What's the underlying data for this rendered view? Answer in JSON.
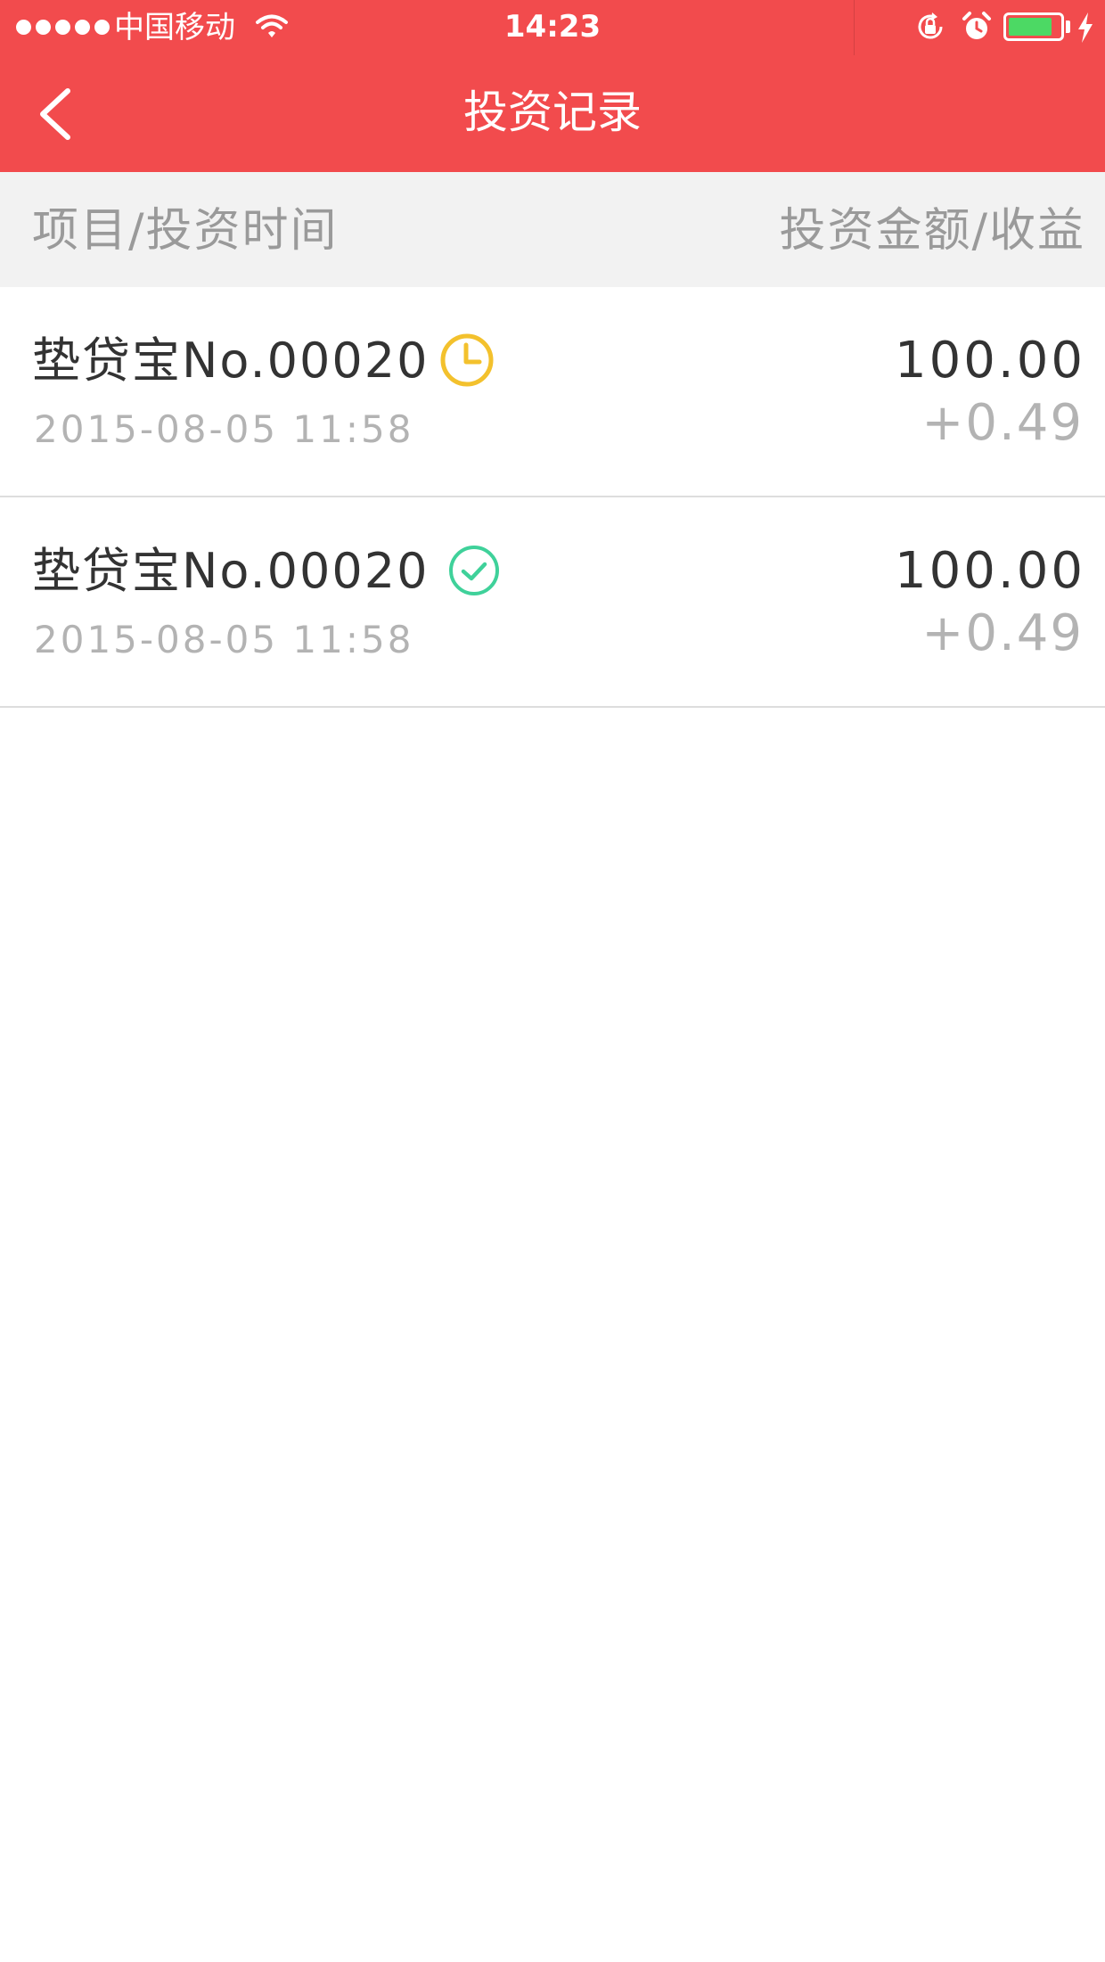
{
  "status_bar": {
    "carrier": "中国移动",
    "time": "14:23",
    "battery_color": "#4cd964"
  },
  "nav": {
    "title": "投资记录",
    "back_icon": "chevron-left-icon",
    "background": "#f24b4d"
  },
  "columns": {
    "left": "项目/投资时间",
    "right": "投资金额/收益"
  },
  "records": [
    {
      "name": "垫贷宝No.00020",
      "status_icon": "clock-icon",
      "status_color": "#f3c12d",
      "time": "2015-08-05 11:58",
      "amount": "100.00",
      "earnings": "+0.49"
    },
    {
      "name": "垫贷宝No.00020",
      "status_icon": "check-circle-icon",
      "status_color": "#3fd19a",
      "time": "2015-08-05 11:58",
      "amount": "100.00",
      "earnings": "+0.49"
    }
  ]
}
